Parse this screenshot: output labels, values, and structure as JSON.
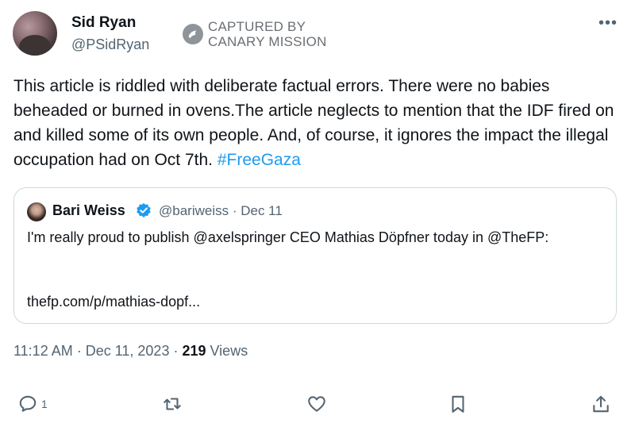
{
  "author": {
    "name": "Sid Ryan",
    "handle": "@PSidRyan"
  },
  "watermark": {
    "line1": "CAPTURED BY",
    "line2": "CANARY MISSION"
  },
  "menu_label": "•••",
  "tweet": {
    "text": "This article is riddled with deliberate factual errors. There were no babies beheaded or burned in ovens.The article neglects to mention that the IDF fired on and killed some of its own people. And, of course, it ignores the impact the illegal occupation had on Oct 7th.",
    "hashtag": "#FreeGaza"
  },
  "quoted": {
    "name": "Bari Weiss",
    "handle_date": "@bariweiss · Dec 11",
    "text": "I'm really proud to publish @axelspringer CEO Mathias Döpfner today in @TheFP:",
    "link": "thefp.com/p/mathias-dopf..."
  },
  "meta": {
    "time_date": "11:12 AM · Dec 11, 2023 · ",
    "views_count": "219",
    "views_label": " Views"
  },
  "actions": {
    "reply_count": "1"
  }
}
